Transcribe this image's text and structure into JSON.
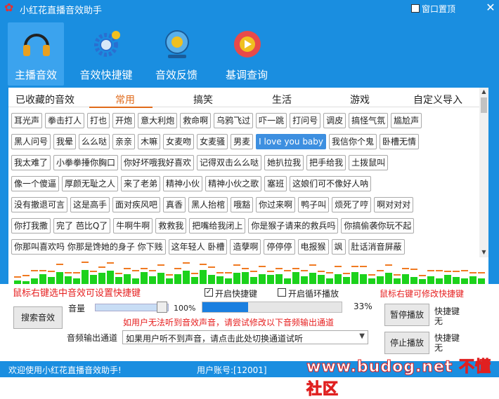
{
  "window": {
    "title": "小红花直播音效助手",
    "pin_label": "窗口置顶",
    "close": "✕",
    "app_icon": "red-flower-icon"
  },
  "toolbar": [
    {
      "label": "主播音效",
      "icon": "headphones-icon"
    },
    {
      "label": "音效快捷键",
      "icon": "gears-icon"
    },
    {
      "label": "音效反馈",
      "icon": "webcam-icon"
    },
    {
      "label": "基调查询",
      "icon": "film-reel-icon"
    }
  ],
  "tabs": [
    "已收藏的音效",
    "常用",
    "搞笑",
    "生活",
    "游戏",
    "自定义导入"
  ],
  "active_tab": "常用",
  "sound_rows": [
    [
      "耳光声",
      "拳击打人",
      "打也",
      "开炮",
      "意大利炮",
      "救命啊",
      "乌鸦飞过",
      "吓一跳",
      "打问号",
      "调皮",
      "搞怪气氛",
      "尴尬声"
    ],
    [
      "黑人问号",
      "我晕",
      "么么哒",
      "亲亲",
      "木嘛",
      "女麦吻",
      "女麦骚",
      "男麦",
      "I love you baby",
      "我信你个鬼",
      "卧槽无情"
    ],
    [
      "我太难了",
      "小拳拳捶你胸口",
      "你好坏哦我好喜欢",
      "记得双击么么哒",
      "她扒拉我",
      "把手给我",
      "土拨鼠叫"
    ],
    [
      "像一个傻逼",
      "厚颜无耻之人",
      "来了老弟",
      "精神小伙",
      "精神小伙之歌",
      "塞班",
      "这娘们可不像好人呐"
    ],
    [
      "没有撤退可言",
      "这是高手",
      "面对疾风吧",
      "真香",
      "黑人抬棺",
      "哦豁",
      "你过来啊",
      "鸭子叫",
      "烦死了哼",
      "啊对对对"
    ],
    [
      "你打我撒",
      "完了 芭比Q了",
      "牛啊牛啊",
      "救救我",
      "把嘴给我闭上",
      "你是猴子请来的救兵吗",
      "你搞偷袭你玩不起"
    ],
    [
      "你那叫喜欢吗 你那是馋她的身子 你下贱",
      "这年轻人 卧槽",
      "造孽啊",
      "停停停",
      "电报猴",
      "飒",
      "肚话消音屏蔽"
    ]
  ],
  "selected_sound": "I love you baby",
  "eq_levels": [
    0.2,
    0.15,
    0.3,
    0.5,
    0.35,
    0.6,
    0.4,
    0.3,
    0.7,
    0.45,
    0.55,
    0.65,
    0.35,
    0.5,
    0.3,
    0.6,
    0.4,
    0.55,
    0.3,
    0.5,
    0.65,
    0.35,
    0.7,
    0.45,
    0.4,
    0.3,
    0.55,
    0.6,
    0.35,
    0.5,
    0.45,
    0.5,
    0.3,
    0.6,
    0.4,
    0.55,
    0.45,
    0.3,
    0.5,
    0.35,
    0.6,
    0.5,
    0.3,
    0.4,
    0.55,
    0.3,
    0.5,
    0.35,
    0.25,
    0.4,
    0.3,
    0.45,
    0.35,
    0.3,
    0.4,
    0.3
  ],
  "controls": {
    "hint_left": "鼠标右键选中音效可设置快捷键",
    "hint_right": "鼠标右键可修改快捷键",
    "enable_hotkey": "开启快捷键",
    "enable_loop": "开启循环播放",
    "volume_label": "音量",
    "volume_value": "100%",
    "volume_level": 1.0,
    "progress_value": "33%",
    "progress_level": 0.33,
    "search_button": "搜索音效",
    "warning": "如用户无法听到音效声音，请尝试修改以下音频输出通道",
    "output_label": "音频输出通道",
    "output_value": "如果用户听不到声音，请点击此处切换通道试听",
    "pause_button": "暂停播放",
    "stop_button": "停止播放",
    "hotkey_label_1": "快捷键",
    "hotkey_value_1": "无",
    "hotkey_label_2": "快捷键",
    "hotkey_value_2": "无"
  },
  "status": {
    "welcome": "欢迎使用小红花直播音效助手!",
    "account": "用户账号:[12001]"
  },
  "watermark": "www.budog.net 不懂社区"
}
